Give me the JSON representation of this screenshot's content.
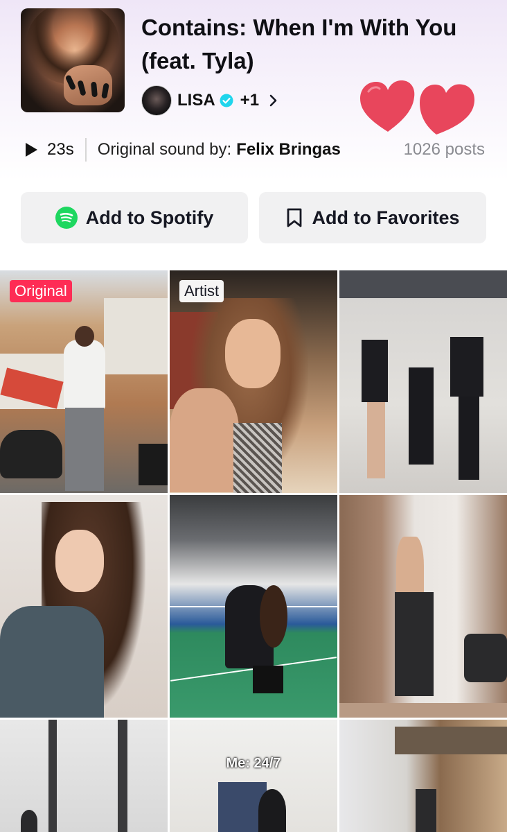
{
  "song": {
    "title": "Contains: When I'm With You (feat. Tyla)",
    "artist": "LISA",
    "extra_artists": "+1",
    "duration": "23s",
    "original_label": "Original sound by:",
    "original_artist": "Felix Bringas",
    "posts": "1026 posts"
  },
  "actions": {
    "spotify_label": "Add to Spotify",
    "favorites_label": "Add to Favorites"
  },
  "grid": {
    "badges": [
      "Original",
      "Artist"
    ],
    "captions": [
      "Me: 24/7"
    ]
  },
  "colors": {
    "accent_red": "#fe2c55",
    "spotify_green": "#1ed760",
    "verified_blue": "#20d5ec",
    "heart": "#e8465c"
  },
  "icons": [
    "play-icon",
    "verified-icon",
    "chevron-right-icon",
    "spotify-icon",
    "bookmark-icon",
    "heart-icon"
  ]
}
